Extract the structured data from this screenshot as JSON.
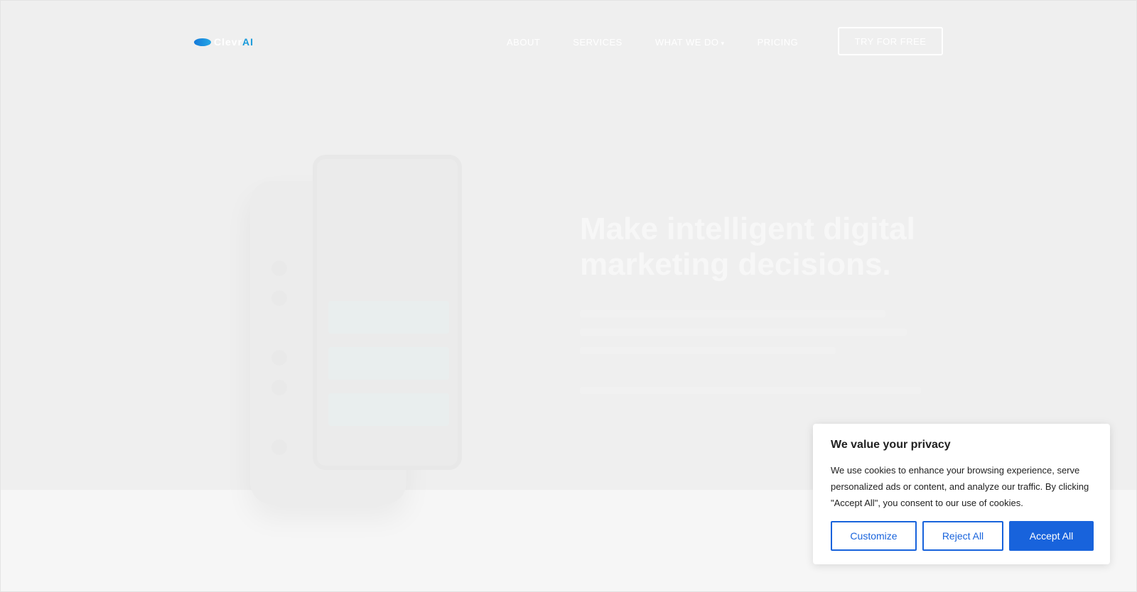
{
  "brand": {
    "logo_text_main": "Clevr",
    "logo_text_accent": "AI"
  },
  "nav": {
    "items": [
      {
        "label": "ABOUT"
      },
      {
        "label": "SERVICES"
      },
      {
        "label": "WHAT WE DO"
      },
      {
        "label": "PRICING"
      }
    ],
    "cta_label": "TRY FOR FREE"
  },
  "hero": {
    "title": "Make intelligent digital marketing decisions."
  },
  "cookie_banner": {
    "title": "We value your privacy",
    "text": "We use cookies to enhance your browsing experience, serve personalized ads or content, and analyze our traffic. By clicking \"Accept All\", you consent to our use of cookies.",
    "customize_label": "Customize",
    "reject_label": "Reject All",
    "accept_label": "Accept All",
    "accent_color": "#1863dc"
  }
}
